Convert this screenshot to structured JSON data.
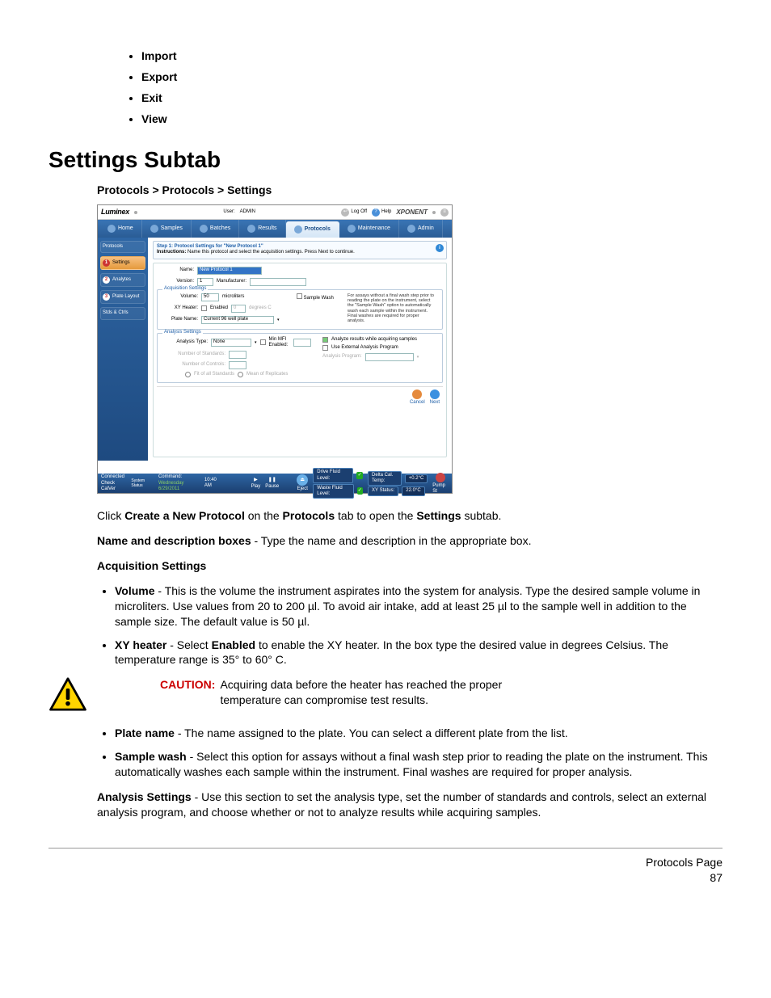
{
  "top_list": [
    "Import",
    "Export",
    "Exit",
    "View"
  ],
  "heading": "Settings Subtab",
  "breadcrumb": [
    "Protocols",
    "Protocols",
    "Settings"
  ],
  "app": {
    "brand": "Luminex",
    "user_label": "User:",
    "user_value": "ADMIN",
    "logoff": "Log Off",
    "help": "Help",
    "product": "XPONENT",
    "nav": [
      "Home",
      "Samples",
      "Batches",
      "Results",
      "Protocols",
      "Maintenance",
      "Admin"
    ],
    "side": {
      "top": "Protocols",
      "items": [
        "Settings",
        "Analytes",
        "Plate Layout",
        "Stds & Ctrls"
      ]
    },
    "step_title": "Step 1: Protocol Settings for \"New Protocol 1\"",
    "instructions_label": "Instructions:",
    "instructions_text": "Name this protocol and select the acquisition settings.  Press Next to continue.",
    "name_label": "Name:",
    "name_value": "New Protocol 1",
    "version_label": "Version:",
    "version_value": "1",
    "manufacturer_label": "Manufacturer:",
    "acq_legend": "Acquisition Settings",
    "volume_label": "Volume:",
    "volume_value": "50",
    "volume_unit": "microliters",
    "xyheater_label": "XY Heater:",
    "enabled_label": "Enabled",
    "xyheater_value": "0",
    "xyheater_unit": "degrees C",
    "plate_label": "Plate Name:",
    "plate_value": "Current 96 well plate",
    "sample_wash_label": "Sample Wash",
    "sample_wash_help": "For assays without a final wash step prior to reading the plate on the instrument, select the \"Sample Wash\" option to automatically wash each sample within the instrument.  Final washes are required for proper analysis.",
    "analysis_legend": "Analysis Settings",
    "analysis_type_label": "Analysis Type:",
    "analysis_type_value": "None",
    "min_mfi_label": "Min MFI Enabled:",
    "num_std_label": "Number of Standards:",
    "num_ctrl_label": "Number of Controls:",
    "fit_std_label": "Fit of all Standards",
    "mean_rep_label": "Mean of Replicates",
    "analyze_while_label": "Analyze results while acquiring samples",
    "use_ext_label": "Use External Analysis Program",
    "analysis_prog_label": "Analysis Program:",
    "cancel": "Cancel",
    "next": "Next",
    "status": {
      "connected": "Connected",
      "check_cal": "Check CalVer",
      "system_status": "System Status",
      "command": "Command:",
      "date": "Wednesday 6/29/2011",
      "time": "10:40 AM",
      "play": "Play",
      "pause": "Pause",
      "eject": "Eject",
      "drive": "Drive Fluid Level:",
      "waste": "Waste Fluid Level:",
      "delta": "Delta Cal. Temp:",
      "delta_val": "+0.2°C",
      "xystat": "XY Status:",
      "xystat_val": "22.0°C",
      "pump": "Pump St"
    }
  },
  "doc": {
    "p1_a": "Click ",
    "p1_b": "Create a New Protocol",
    "p1_c": " on the ",
    "p1_d": "Protocols",
    "p1_e": " tab to open the ",
    "p1_f": "Settings",
    "p1_g": " subtab.",
    "p2_a": "Name and description boxes",
    "p2_b": " - Type the name and description in the appropriate box.",
    "p3": "Acquisition Settings",
    "b1_a": "Volume",
    "b1_b": " - This is the volume the instrument aspirates into the system for analysis. Type the desired sample volume in microliters. Use values from 20 to 200 µl. To avoid air intake, add at least 25 µl to the sample well in addition to the sample size. The default value is 50 µl.",
    "b2_a": "XY heater",
    "b2_b": " - Select ",
    "b2_c": "Enabled",
    "b2_d": " to enable the XY heater. In the box type the desired value in degrees Celsius. The temperature range is 35° to 60° C.",
    "caution_label": "CAUTION:",
    "caution_text": "Acquiring data before the heater has reached the proper temperature can compromise test results.",
    "b3_a": "Plate name",
    "b3_b": " - The name assigned to the plate. You can select a different plate from the list.",
    "b4_a": "Sample wash",
    "b4_b": " - Select this option for assays without a final wash step prior to reading the plate on the instrument. This automatically washes each sample within the instrument. Final washes are required for proper analysis.",
    "p4_a": "Analysis Settings",
    "p4_b": " - Use this section to set the analysis type, set the number of standards and controls, select an external analysis program, and choose whether or not to analyze results while acquiring samples."
  },
  "page_footer_title": "Protocols Page",
  "page_number": "87"
}
